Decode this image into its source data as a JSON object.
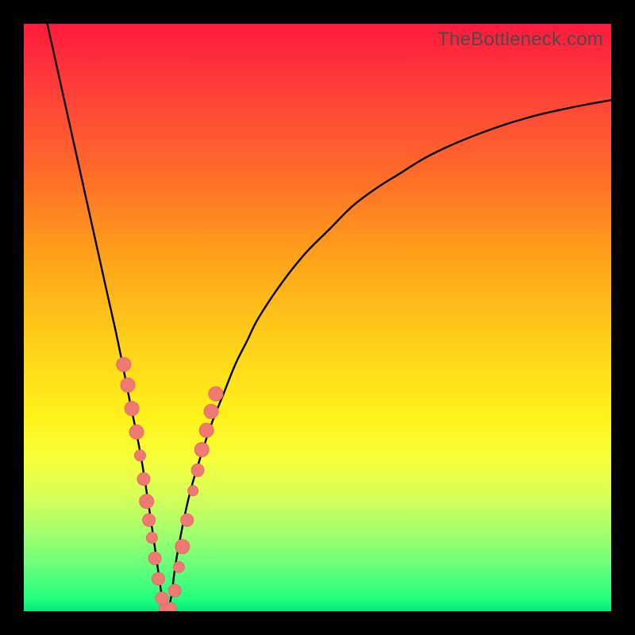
{
  "watermark": "TheBottleneck.com",
  "colors": {
    "frame": "#000000",
    "curve": "#000000",
    "marker_fill": "#ef7a74",
    "marker_stroke": "#e66a64",
    "gradient_top": "#ff1a3c",
    "gradient_bottom": "#00e97a"
  },
  "chart_data": {
    "type": "line",
    "title": "",
    "xlabel": "",
    "ylabel": "",
    "xlim": [
      0,
      100
    ],
    "ylim": [
      0,
      100
    ],
    "note": "Axes are implicit (no ticks shown). y is a bottleneck-percentage-like value; minimum occurs near x≈24.",
    "series": [
      {
        "name": "bottleneck-curve",
        "x": [
          4,
          6,
          8,
          10,
          12,
          14,
          16,
          18,
          20,
          22,
          23,
          24,
          25,
          26,
          28,
          30,
          32,
          34,
          36,
          38,
          40,
          44,
          48,
          52,
          56,
          60,
          64,
          68,
          72,
          76,
          80,
          84,
          88,
          92,
          96,
          100
        ],
        "y": [
          100,
          91,
          82,
          73,
          64,
          55,
          46,
          36,
          26,
          13,
          6,
          0,
          2,
          9,
          19,
          26,
          32,
          37,
          42,
          46,
          50,
          56,
          61,
          65,
          69,
          72,
          74.5,
          77,
          79,
          80.7,
          82.2,
          83.5,
          84.6,
          85.5,
          86.3,
          87
        ]
      }
    ],
    "markers": [
      {
        "x": 17,
        "y": 42,
        "r": 9
      },
      {
        "x": 17.7,
        "y": 38.5,
        "r": 9
      },
      {
        "x": 18.4,
        "y": 34.5,
        "r": 9
      },
      {
        "x": 19.2,
        "y": 30.5,
        "r": 9
      },
      {
        "x": 19.8,
        "y": 26.5,
        "r": 7
      },
      {
        "x": 20.4,
        "y": 22.5,
        "r": 8
      },
      {
        "x": 20.9,
        "y": 18.7,
        "r": 9
      },
      {
        "x": 21.3,
        "y": 15.5,
        "r": 8
      },
      {
        "x": 21.8,
        "y": 12.5,
        "r": 7
      },
      {
        "x": 22.3,
        "y": 9,
        "r": 8
      },
      {
        "x": 22.9,
        "y": 5.5,
        "r": 8
      },
      {
        "x": 23.5,
        "y": 2.2,
        "r": 8
      },
      {
        "x": 24.1,
        "y": 0.2,
        "r": 8
      },
      {
        "x": 24.9,
        "y": 0.4,
        "r": 8
      },
      {
        "x": 25.7,
        "y": 3.5,
        "r": 8
      },
      {
        "x": 26.4,
        "y": 7.5,
        "r": 7
      },
      {
        "x": 27,
        "y": 11,
        "r": 9
      },
      {
        "x": 27.8,
        "y": 15.5,
        "r": 8
      },
      {
        "x": 28.8,
        "y": 20.5,
        "r": 6.5
      },
      {
        "x": 29.6,
        "y": 24,
        "r": 8
      },
      {
        "x": 30.3,
        "y": 27.5,
        "r": 9
      },
      {
        "x": 31.1,
        "y": 30.8,
        "r": 9
      },
      {
        "x": 31.9,
        "y": 34,
        "r": 9
      },
      {
        "x": 32.7,
        "y": 37,
        "r": 9
      }
    ]
  }
}
